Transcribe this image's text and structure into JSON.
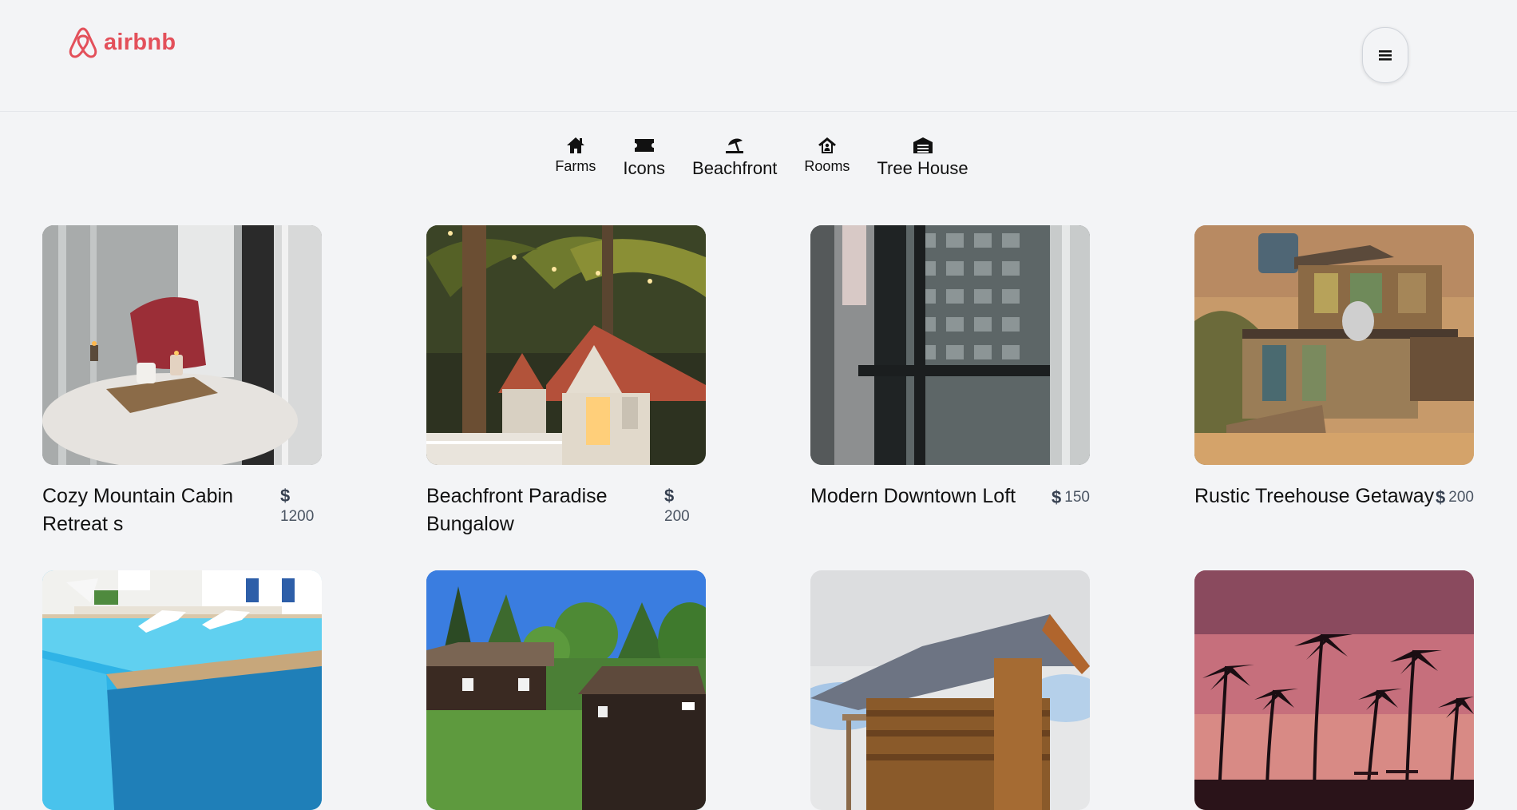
{
  "brand": {
    "name": "airbnb",
    "color": "#e3505a",
    "icon": "airbnb-logo-icon"
  },
  "header": {
    "menu_icon": "hamburger-icon"
  },
  "categories": [
    {
      "label": "Farms",
      "icon": "house-icon"
    },
    {
      "label": "Icons",
      "icon": "ticket-icon"
    },
    {
      "label": "Beachfront",
      "icon": "umbrella-beach-icon"
    },
    {
      "label": "Rooms",
      "icon": "house-user-icon"
    },
    {
      "label": "Tree House",
      "icon": "warehouse-icon"
    }
  ],
  "listings": [
    {
      "title": "Cozy Mountain Cabin Retreat s",
      "currency": "$",
      "price": "1200",
      "image": "cozy window seat with candle and pillow"
    },
    {
      "title": "Beachfront Paradise Bungalow",
      "currency": "$",
      "price": "200",
      "image": "bungalow under palm trees"
    },
    {
      "title": "Modern Downtown Loft",
      "currency": "$",
      "price": "150",
      "image": "window overlooking city buildings"
    },
    {
      "title": "Rustic Treehouse Getaway",
      "currency": "$",
      "price": "200",
      "image": "rustic wooden shack"
    },
    {
      "title": "",
      "currency": "",
      "price": "",
      "image": "swimming pool with lounge chairs"
    },
    {
      "title": "",
      "currency": "",
      "price": "",
      "image": "wooden cabins in forest"
    },
    {
      "title": "",
      "currency": "",
      "price": "",
      "image": "small wooden hut"
    },
    {
      "title": "",
      "currency": "",
      "price": "",
      "image": "palm trees at sunset"
    }
  ]
}
